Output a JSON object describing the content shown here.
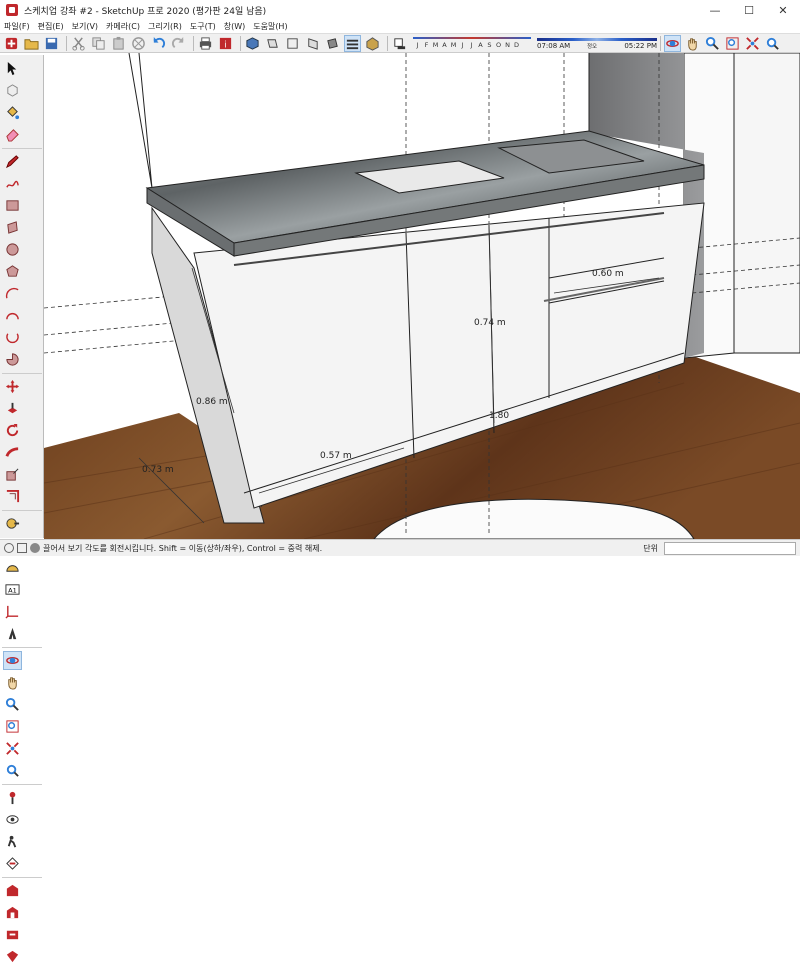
{
  "window": {
    "title": "스케치업 강좌 #2 - SketchUp 프로 2020 (평가판 24일 남음)",
    "minimize": "—",
    "maximize": "☐",
    "close": "✕"
  },
  "menu": [
    "파일(F)",
    "편집(E)",
    "보기(V)",
    "카메라(C)",
    "그리기(R)",
    "도구(T)",
    "창(W)",
    "도움말(H)"
  ],
  "toolbar": {
    "months": [
      "J",
      "F",
      "M",
      "A",
      "M",
      "J",
      "J",
      "A",
      "S",
      "O",
      "N",
      "D"
    ],
    "sunrise": "07:08 AM",
    "noon": "정오",
    "sunset": "05:22 PM"
  },
  "viewport": {
    "dimensions": {
      "height_left": "0.86 m",
      "width_bottom": "0.57 m",
      "depth_floor": "0.73 m",
      "height_center": "0.74 m",
      "height_lower": "1.80",
      "drawer_width": "0.60 m"
    },
    "colors": {
      "countertop": "#6e7375",
      "cabinet": "#f4f4f4",
      "floor": "#7a4a26",
      "wall_dark": "#8a8b8d",
      "outline": "#222222"
    }
  },
  "status": {
    "message": "끌어서 보기 각도를 회전시킵니다. Shift = 이동(상하/좌우), Control = 중력 해제.",
    "unit_label": "단위",
    "unit_value": ""
  }
}
